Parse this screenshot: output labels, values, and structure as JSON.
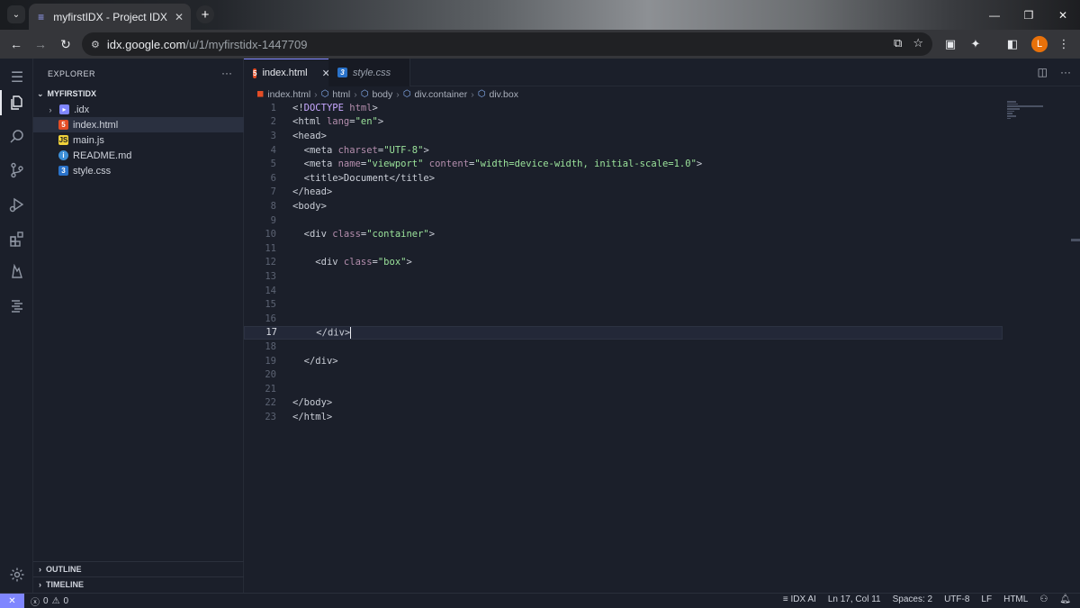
{
  "browser": {
    "tab_title": "myfirstIDX - Project IDX",
    "url_host": "idx.google.com",
    "url_path": "/u/1/myfirstidx-1447709",
    "profile_initial": "L"
  },
  "activity_bar": {
    "icons": [
      "explorer-icon",
      "search-icon",
      "source-control-icon",
      "run-debug-icon",
      "extensions-icon",
      "firebase-icon",
      "idx-ai-icon",
      "settings-icon"
    ]
  },
  "explorer": {
    "title": "EXPLORER",
    "root": "MYFIRSTIDX",
    "items": [
      {
        "name": ".idx",
        "type": "folder"
      },
      {
        "name": "index.html",
        "type": "html"
      },
      {
        "name": "main.js",
        "type": "js"
      },
      {
        "name": "README.md",
        "type": "info"
      },
      {
        "name": "style.css",
        "type": "css"
      }
    ],
    "outline": "OUTLINE",
    "timeline": "TIMELINE"
  },
  "editor": {
    "tabs": [
      {
        "label": "index.html",
        "active": true
      },
      {
        "label": "style.css",
        "active": false
      }
    ],
    "breadcrumbs": [
      "index.html",
      "html",
      "body",
      "div.container",
      "div.box"
    ],
    "current_line": 17,
    "lines": [
      "1",
      "2",
      "3",
      "4",
      "5",
      "6",
      "7",
      "8",
      "9",
      "10",
      "11",
      "12",
      "13",
      "14",
      "15",
      "16",
      "17",
      "18",
      "19",
      "20",
      "21",
      "22",
      "23"
    ]
  },
  "status": {
    "errors": "0",
    "warnings": "0",
    "ai": "IDX AI",
    "position": "Ln 17, Col 11",
    "spaces": "Spaces: 2",
    "encoding": "UTF-8",
    "eol": "LF",
    "language": "HTML"
  },
  "colors": {
    "accent": "#7f86ff",
    "html_icon": "#e44d26",
    "js_icon": "#f1d23a",
    "css_icon": "#2a72c9",
    "string": "#9be39b",
    "attribute": "#b48ead"
  }
}
